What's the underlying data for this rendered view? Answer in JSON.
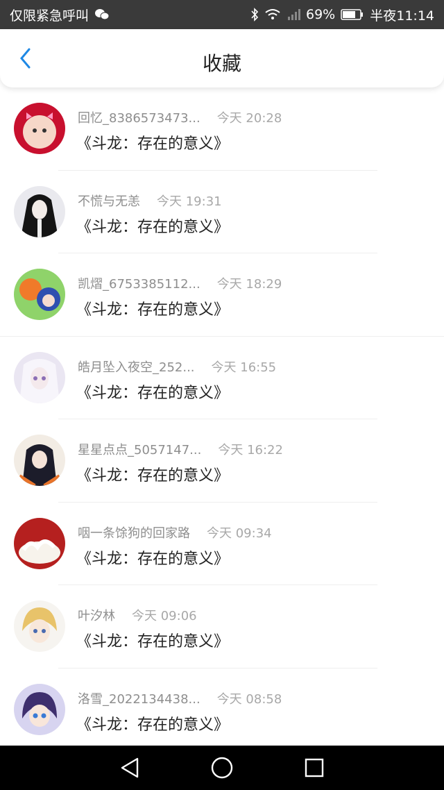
{
  "status_bar": {
    "left_text": "仅限紧急呼叫",
    "battery": "69%",
    "time": "半夜11:14"
  },
  "header": {
    "title": "收藏",
    "back_icon": "chevron-left-icon",
    "accent": "#1e88e5"
  },
  "favorites": [
    {
      "user": "回忆_8386573473...",
      "time": "今天 20:28",
      "title": "《斗龙：存在的意义》"
    },
    {
      "user": "不慌与无恙",
      "time": "今天 19:31",
      "title": "《斗龙：存在的意义》"
    },
    {
      "user": "凯熠_6753385112...",
      "time": "今天 18:29",
      "title": "《斗龙：存在的意义》"
    },
    {
      "user": "皓月坠入夜空_252...",
      "time": "今天 16:55",
      "title": "《斗龙：存在的意义》"
    },
    {
      "user": "星星点点_5057147...",
      "time": "今天 16:22",
      "title": "《斗龙：存在的意义》"
    },
    {
      "user": "咽一条馀狗的回家路",
      "time": "今天 09:34",
      "title": "《斗龙：存在的意义》"
    },
    {
      "user": "叶汐林",
      "time": "今天 09:06",
      "title": "《斗龙：存在的意义》"
    },
    {
      "user": "洛雪_2022134438...",
      "time": "今天 08:58",
      "title": "《斗龙：存在的意义》"
    }
  ],
  "nav_bar": {
    "back": "triangle-back-icon",
    "home": "circle-home-icon",
    "recents": "square-recents-icon"
  }
}
